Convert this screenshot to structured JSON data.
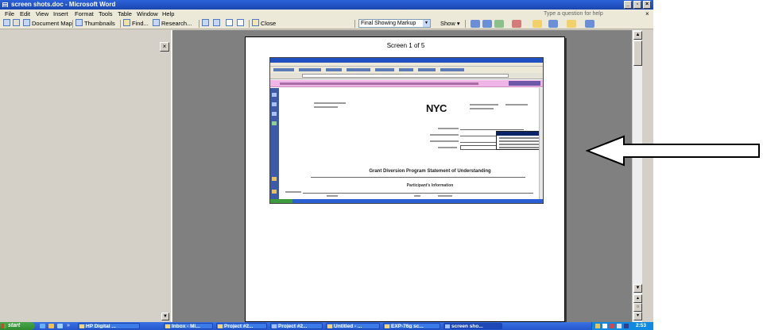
{
  "window": {
    "title": "screen shots.doc - Microsoft Word"
  },
  "menubar": {
    "items": [
      "File",
      "Edit",
      "View",
      "Insert",
      "Format",
      "Tools",
      "Table",
      "Window",
      "Help"
    ],
    "help_placeholder": "Type a question for help"
  },
  "toolbar": {
    "document_map": "Document Map",
    "thumbnails": "Thumbnails",
    "find": "Find...",
    "research": "Research...",
    "close": "Close",
    "markup_mode": "Final Showing Markup",
    "show": "Show"
  },
  "document": {
    "page_heading": "Screen 1 of 5",
    "embedded_logo": "NYC",
    "embedded_form_title": "Grant Diversion Program Statement of Understanding",
    "embedded_section": "Participant's Information"
  },
  "taskbar": {
    "start": "start",
    "tasks": [
      "HP Digital ...",
      "Inbox - Mi...",
      "Project #2...",
      "Project #2...",
      "Untitled - ...",
      "EXP-76g sc...",
      "screen sho..."
    ],
    "clock": "2:53 PM"
  },
  "colors": {
    "title_bar": "#1b45b0",
    "doc_background": "#808080",
    "taskbar": "#2456cc",
    "start_button": "#2f8a2f",
    "embedded_banner": "#f0b5e6"
  },
  "icons": {
    "arrow": "arrow-left-icon",
    "close_pane": "close-icon"
  }
}
